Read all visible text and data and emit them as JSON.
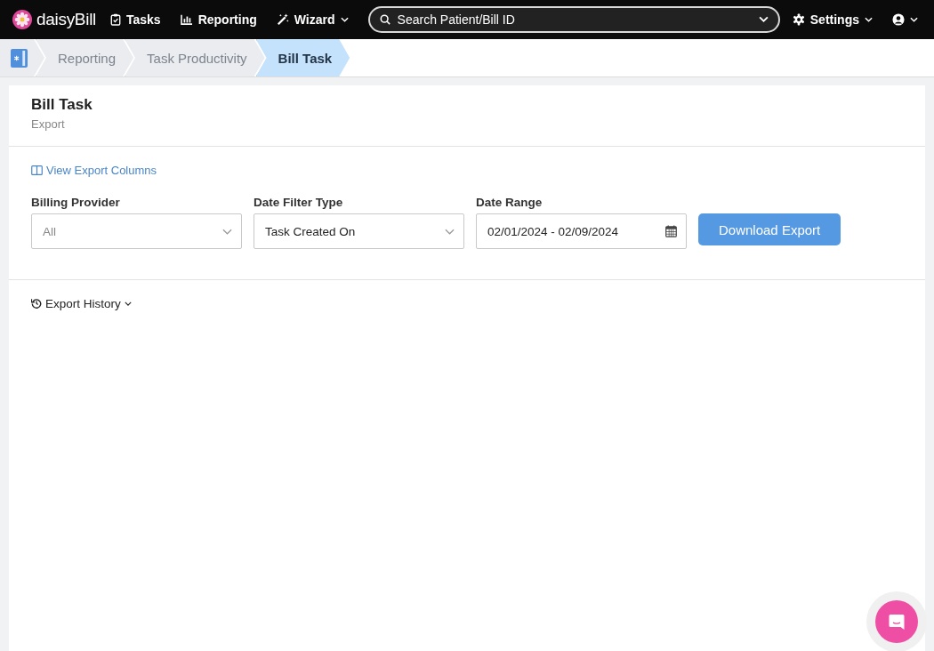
{
  "navbar": {
    "logo": "daisyBill",
    "items": [
      {
        "label": "Tasks",
        "kind": "tasks",
        "dropdown": false
      },
      {
        "label": "Reporting",
        "kind": "reporting",
        "dropdown": false
      },
      {
        "label": "Wizard",
        "kind": "wizard",
        "dropdown": true
      }
    ],
    "search": {
      "placeholder": "Search Patient/Bill ID"
    },
    "settings": {
      "label": "Settings"
    }
  },
  "breadcrumbs": [
    {
      "label": "Reporting",
      "selected": false
    },
    {
      "label": "Task Productivity",
      "selected": false
    },
    {
      "label": "Bill Task",
      "selected": true
    }
  ],
  "header": {
    "title": "Bill Task",
    "subtitle": "Export"
  },
  "view_columns_link": "View Export Columns",
  "filters": [
    {
      "label": "Billing Provider",
      "kind": "select",
      "placeholder": "All"
    },
    {
      "label": "Date Filter Type",
      "kind": "select",
      "value": "Task Created On"
    },
    {
      "label": "Date Range",
      "kind": "date",
      "value": "02/01/2024 - 02/09/2024"
    }
  ],
  "download_button": "Download Export",
  "export_history": "Export History"
}
